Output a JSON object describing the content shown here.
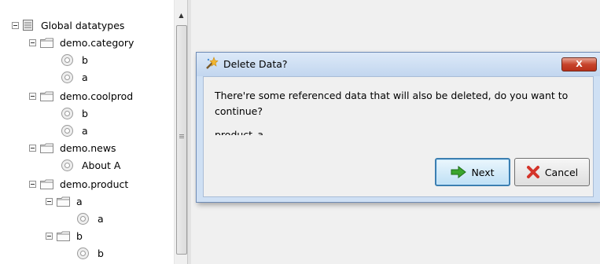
{
  "tree": {
    "root": {
      "label": "Global datatypes",
      "icon": "database-icon"
    },
    "nodes": [
      {
        "label": "demo.category",
        "type": "folder"
      },
      {
        "label": "b",
        "type": "item"
      },
      {
        "label": "a",
        "type": "item"
      },
      {
        "label": "demo.coolprod",
        "type": "folder"
      },
      {
        "label": "b",
        "type": "item"
      },
      {
        "label": "a",
        "type": "item"
      },
      {
        "label": "demo.news",
        "type": "folder"
      },
      {
        "label": "About A",
        "type": "item"
      },
      {
        "label": "demo.product",
        "type": "folder"
      },
      {
        "label": "a",
        "type": "folder"
      },
      {
        "label": "a",
        "type": "item"
      },
      {
        "label": "b",
        "type": "folder"
      },
      {
        "label": "b",
        "type": "item"
      }
    ]
  },
  "dialog": {
    "title": "Delete Data?",
    "close_label": "X",
    "message": "There're some referenced data that will also be deleted, do you want to continue?",
    "referenced_item": "product_a",
    "next_label": "Next",
    "cancel_label": "Cancel"
  },
  "colors": {
    "dialog_frame": "#cfe0f4",
    "close_button": "#c7432b",
    "next_arrow": "#3aa52d",
    "cancel_x": "#d4342a"
  }
}
